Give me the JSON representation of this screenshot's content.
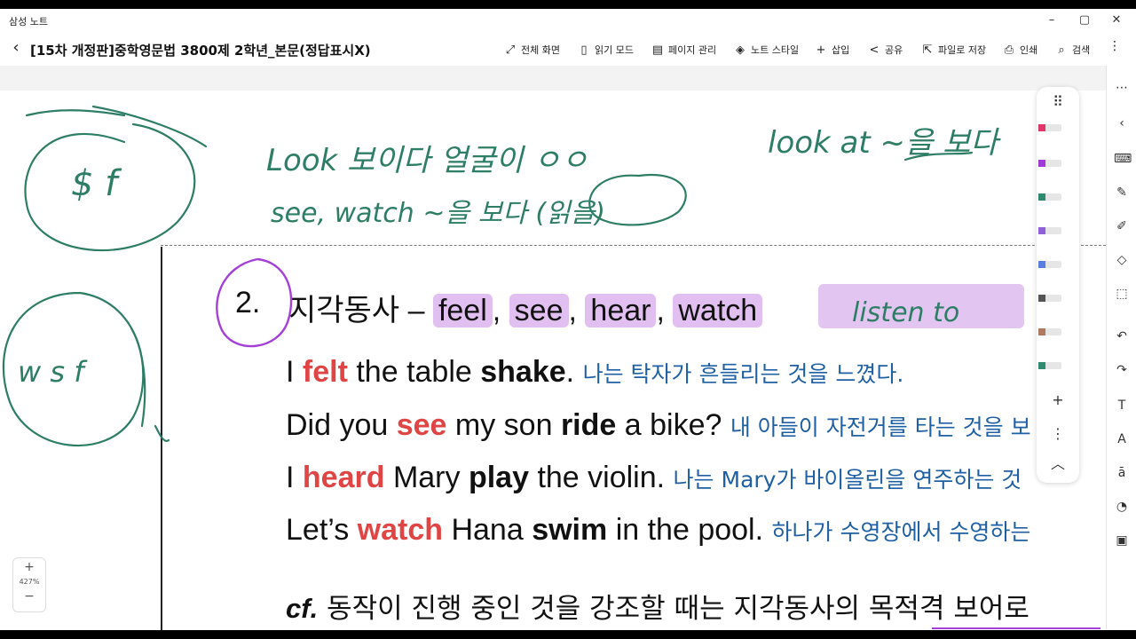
{
  "app": {
    "title": "삼성 노트"
  },
  "window_controls": {
    "minimize": "–",
    "maximize": "▢",
    "close": "✕"
  },
  "toolbar": {
    "back": "‹",
    "doc_title": "[15차 개정판]중학영문법 3800제 2학년_본문(정답표시X)",
    "buttons": [
      {
        "icon": "fullscreen-icon",
        "glyph": "⤢",
        "label": "전체 화면"
      },
      {
        "icon": "reading-mode-icon",
        "glyph": "▯",
        "label": "읽기 모드"
      },
      {
        "icon": "page-manage-icon",
        "glyph": "▤",
        "label": "페이지 관리"
      },
      {
        "icon": "note-style-icon",
        "glyph": "◈",
        "label": "노트 스타일"
      },
      {
        "icon": "plus-icon",
        "glyph": "+",
        "label": "삽입"
      },
      {
        "icon": "share-icon",
        "glyph": "<",
        "label": "공유"
      },
      {
        "icon": "save-file-icon",
        "glyph": "⇱",
        "label": "파일로 저장"
      },
      {
        "icon": "print-icon",
        "glyph": "⎙",
        "label": "인쇄"
      },
      {
        "icon": "search-icon",
        "glyph": "⌕",
        "label": "검색"
      }
    ],
    "more": "⋮"
  },
  "zoom": {
    "plus": "+",
    "level": "427%",
    "minus": "−"
  },
  "handwriting": {
    "line1_left": "Look 보이다 얼굴이 ㅇㅇ",
    "line1_right": "look at ~을 보다",
    "line2": "see, watch ~을 보다 (읽을)",
    "side_top": "$ f",
    "side_bottom": "w s f",
    "heading_extra": "listen to"
  },
  "content": {
    "number": "2.",
    "heading_prefix": "지각동사 –",
    "verbs": [
      "feel",
      "see",
      "hear",
      "watch"
    ],
    "sentences": [
      {
        "pre": "I ",
        "verb": "felt",
        "mid": " the table ",
        "obj": "shake",
        "post": ".",
        "kr": "나는 탁자가 흔들리는 것을 느꼈다."
      },
      {
        "pre": "Did you ",
        "verb": "see",
        "mid": " my son ",
        "obj": "ride",
        "post": " a bike?",
        "kr": "내 아들이 자전거를 타는 것을 보"
      },
      {
        "pre": "I ",
        "verb": "heard",
        "mid": " Mary ",
        "obj": "play",
        "post": " the violin.",
        "kr": "나는 Mary가 바이올린을 연주하는 것"
      },
      {
        "pre": "Let’s ",
        "verb": "watch",
        "mid": " Hana ",
        "obj": "swim",
        "post": " in the pool.",
        "kr": "하나가 수영장에서 수영하는"
      }
    ],
    "cf_label": "cf.",
    "cf_text": "동작이 진행 중인 것을 강조할 때는 지각동사의 목적격 보어로"
  },
  "pen_tray": {
    "grip": "⠿",
    "pens": [
      "#e0386b",
      "#a03ad8",
      "#2e8b6e",
      "#8f5fd8",
      "#5b7fe0",
      "#555555",
      "#b07a60",
      "#2e8b6e"
    ],
    "add": "+",
    "more": "⋮",
    "collapse": "︿"
  },
  "right_rail": [
    "grid-icon",
    "chevron-left-icon",
    "keyboard-icon",
    "pen-icon",
    "highlighter-icon",
    "eraser-icon",
    "lasso-icon",
    "undo-icon",
    "redo-icon",
    "text-icon",
    "handwriting-text-icon",
    "convert-icon",
    "shapes-icon",
    "image-icon"
  ],
  "colors": {
    "ink_green": "#2e7d65",
    "ink_purple": "#a540d6",
    "verb_red": "#e04545",
    "korean_blue": "#1f5fa3",
    "highlight": "#c88ce6"
  }
}
